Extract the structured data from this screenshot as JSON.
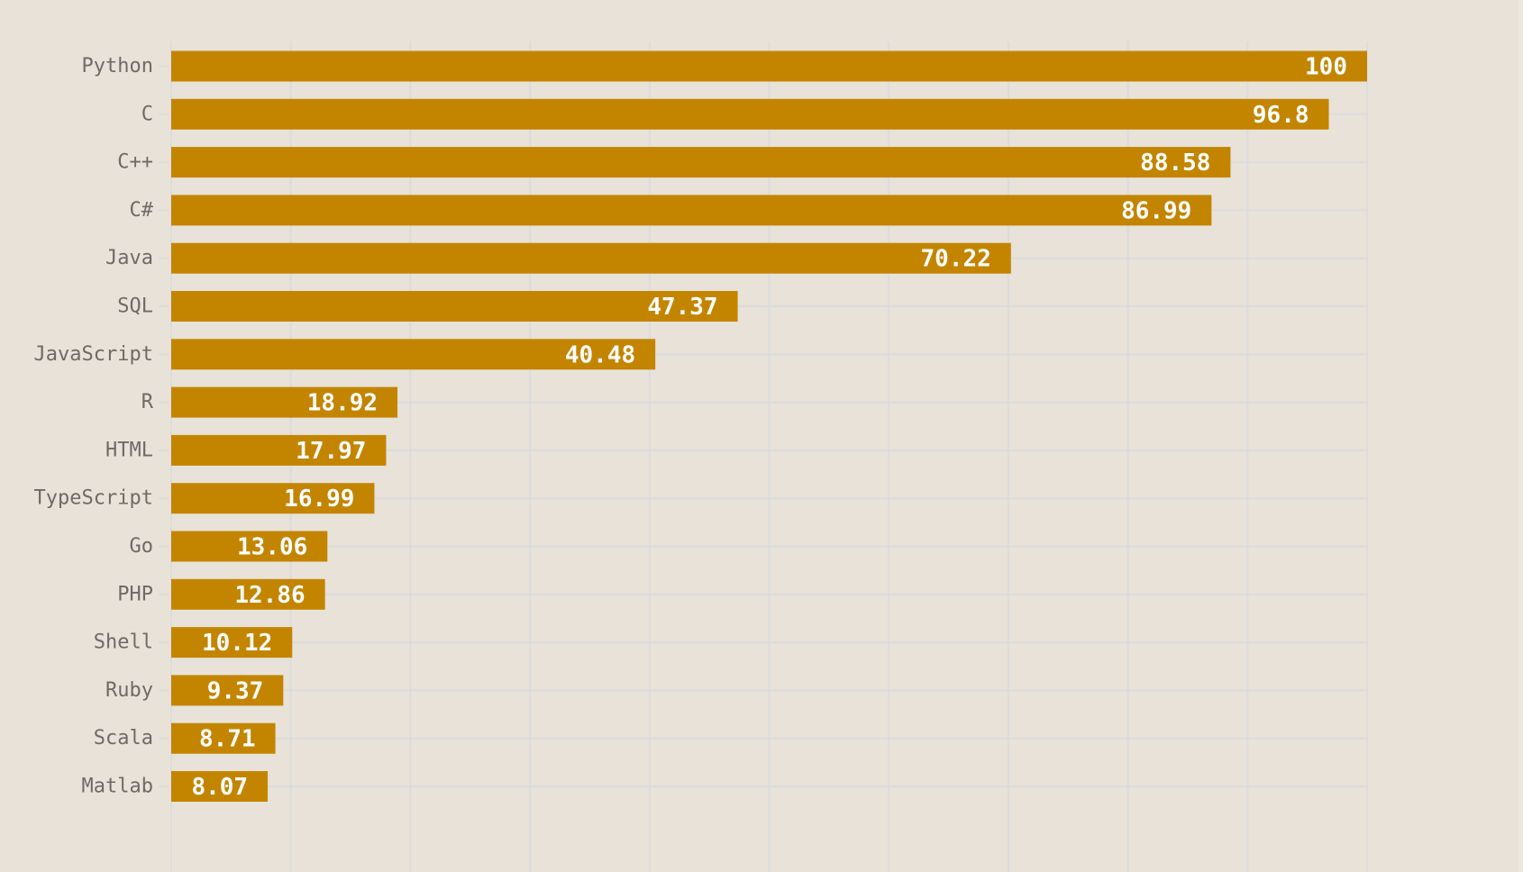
{
  "chart_data": {
    "type": "bar",
    "orientation": "horizontal",
    "title": "",
    "xlabel": "",
    "ylabel": "",
    "categories": [
      "Python",
      "C",
      "C++",
      "C#",
      "Java",
      "SQL",
      "JavaScript",
      "R",
      "HTML",
      "TypeScript",
      "Go",
      "PHP",
      "Shell",
      "Ruby",
      "Scala",
      "Matlab"
    ],
    "values": [
      100,
      96.8,
      88.58,
      86.99,
      70.22,
      47.37,
      40.48,
      18.92,
      17.97,
      16.99,
      13.06,
      12.86,
      10.12,
      9.37,
      8.71,
      8.07
    ],
    "labels": [
      "100",
      "96.8",
      "88.58",
      "86.99",
      "70.22",
      "47.37",
      "40.48",
      "18.92",
      "17.97",
      "16.99",
      "13.06",
      "12.86",
      "10.12",
      "9.37",
      "8.71",
      "8.07"
    ],
    "xlim": [
      0,
      100
    ],
    "grid": true,
    "grid_step": 10,
    "legend": "none",
    "colors": {
      "background": "#e8e2d9",
      "bar": "#c38500",
      "grid": "#dcdcdc",
      "tick_label": "#6f6a66",
      "value_label": "#ffffff"
    }
  }
}
